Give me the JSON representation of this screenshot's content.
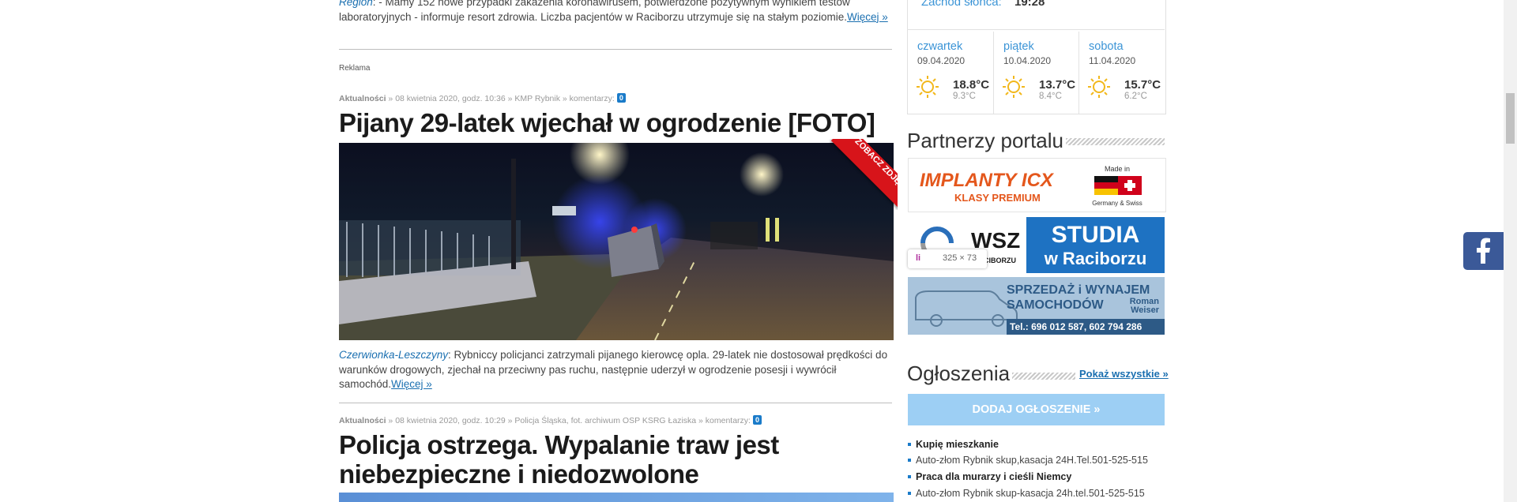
{
  "top_article": {
    "place": "Region",
    "text": ": - Mamy 152 nowe przypadki zakażenia koronawirusem, potwierdzone pozytywnym wynikiem testów laboratoryjnych - informuje resort zdrowia. Liczba pacjentów w Raciborzu utrzymuje się na stałym poziomie.",
    "more": "Więcej »"
  },
  "ad_label": "Reklama",
  "article1": {
    "category": "Aktualności",
    "meta": " » 08 kwietnia 2020, godz. 10:36 » KMP Rybnik » komentarzy:",
    "comments": "0",
    "title": "Pijany 29-latek wjechał w ogrodzenie [FOTO]",
    "ribbon": "ZOBACZ ZDJĘCIA",
    "place": "Czerwionka-Leszczyny",
    "text": ": Rybniccy policjanci zatrzymali pijanego kierowcę opla. 29-latek nie dostosował prędkości do warunków drogowych, zjechał na przeciwny pas ruchu, następnie uderzył w ogrodzenie posesji i wywrócił samochód.",
    "more": "Więcej »"
  },
  "article2": {
    "category": "Aktualności",
    "meta": " » 08 kwietnia 2020, godz. 10:29 » Policja Śląska, fot. archiwum OSP KSRG Łaziska » komentarzy:",
    "comments": "0",
    "title_line1": "Policja ostrzega. Wypalanie traw jest",
    "title_line2": "niebezpieczne i niedozwolone"
  },
  "weather": {
    "sunset_label": "Zachód słońca:",
    "sunset_time": "19:28",
    "days": [
      {
        "name": "czwartek",
        "date": "09.04.2020",
        "high": "18.8°C",
        "low": "9.3°C"
      },
      {
        "name": "piątek",
        "date": "10.04.2020",
        "high": "13.7°C",
        "low": "8.4°C"
      },
      {
        "name": "sobota",
        "date": "11.04.2020",
        "high": "15.7°C",
        "low": "6.2°C"
      }
    ],
    "icon": "sun-icon"
  },
  "partners": {
    "title": "Partnerzy portalu",
    "implanty": {
      "brand": "IMPLANTY ICX",
      "sub": "KLASY PREMIUM",
      "made": "Made in",
      "origin": "Germany & Swiss"
    },
    "studia": {
      "partial": "WSZ",
      "small": "RACIBORZU",
      "big1": "STUDIA",
      "big2": "w Raciborzu"
    },
    "tooltip": {
      "tag": "li",
      "size": "325 × 73"
    },
    "cars": {
      "line1": "SPRZEDAŻ i WYNAJEM",
      "line2": "SAMOCHODÓW",
      "owner": "Roman Weiser",
      "phone": "Tel.: 696 012 587, 602 794 286"
    }
  },
  "ads": {
    "title": "Ogłoszenia",
    "show_all": "Pokaż wszystkie »",
    "add_button": "DODAJ OGŁOSZENIE »",
    "items": [
      {
        "text": "Kupię mieszkanie",
        "bold": true
      },
      {
        "text": "Auto-złom Rybnik skup,kasacja 24H.Tel.501-525-515",
        "bold": false
      },
      {
        "text": "Praca dla murarzy i cieśli Niemcy",
        "bold": true
      },
      {
        "text": "Auto-złom Rybnik skup-kasacja 24h.tel.501-525-515",
        "bold": false
      }
    ]
  },
  "colors": {
    "link": "#1a6fb0",
    "badge": "#1a7bc9",
    "facebook": "#3b5998",
    "button": "#9dcff4",
    "ribbon": "#d7141a"
  }
}
